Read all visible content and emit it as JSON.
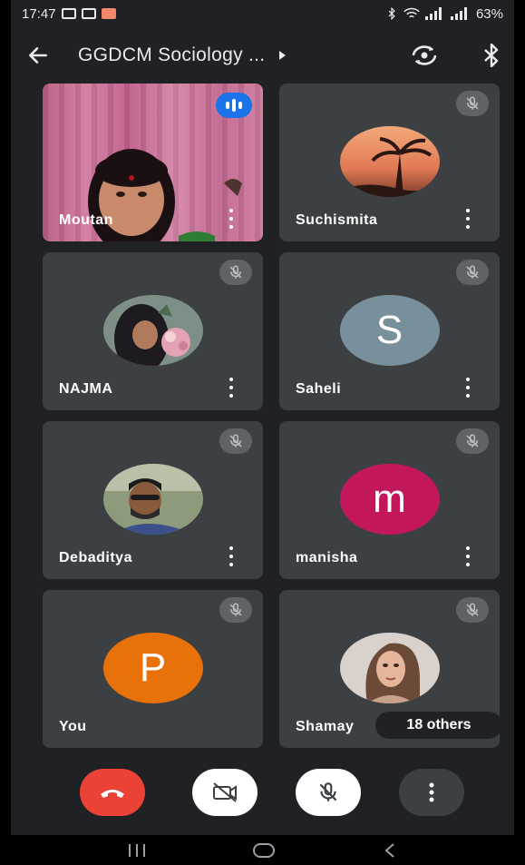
{
  "status_bar": {
    "time": "17:47",
    "battery": "63%"
  },
  "top_bar": {
    "title": "GGDCM Sociology ...",
    "icons": [
      "back-arrow-icon",
      "caret-right-icon",
      "switch-camera-icon",
      "bluetooth-icon"
    ]
  },
  "participants": [
    {
      "name": "Moutan",
      "type": "video",
      "speaking": true
    },
    {
      "name": "Suchismita",
      "type": "photo",
      "muted": true
    },
    {
      "name": "NAJMA",
      "type": "photo",
      "muted": true
    },
    {
      "name": "Saheli",
      "type": "initial",
      "initial": "S",
      "color": "#78909c",
      "muted": true
    },
    {
      "name": "Debaditya",
      "type": "photo",
      "muted": true
    },
    {
      "name": "manisha",
      "type": "initial",
      "initial": "m",
      "color": "#c2185b",
      "muted": true
    },
    {
      "name": "You",
      "type": "initial",
      "initial": "P",
      "color": "#e8710a",
      "muted": true
    },
    {
      "name": "Shamay",
      "type": "photo",
      "muted": true
    }
  ],
  "others_label": "18 others",
  "controls": {
    "icons": [
      "end-call-icon",
      "camera-off-icon",
      "mic-off-icon",
      "more-vert-icon"
    ],
    "colors": {
      "end_call": "#ea4335",
      "toggle_bg": "#ffffff",
      "more_bg": "#3c4043"
    }
  },
  "nav_bar": {
    "icons": [
      "recent-apps-icon",
      "home-icon",
      "back-nav-icon"
    ]
  }
}
